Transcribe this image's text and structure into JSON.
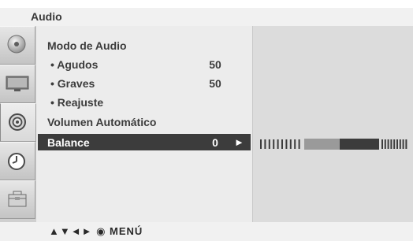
{
  "title": "Audio",
  "icons": [
    "picture-icon",
    "screen-icon",
    "audio-icon",
    "time-icon",
    "option-icon"
  ],
  "active_icon": "audio-icon",
  "menu": {
    "items": [
      {
        "label": "Modo de Audio",
        "value": ""
      },
      {
        "label": "• Agudos",
        "value": "50"
      },
      {
        "label": "• Graves",
        "value": "50"
      },
      {
        "label": "• Reajuste",
        "value": ""
      },
      {
        "label": "Volumen Automático",
        "value": ""
      },
      {
        "label": "Balance",
        "value": "0",
        "arrow": "►"
      }
    ],
    "selected": "Balance"
  },
  "balance": {
    "value": 0,
    "range": [
      -50,
      50
    ]
  },
  "footer": {
    "nav_hint": "▲▼◄► ◉ MENÚ"
  },
  "colors": {
    "selected_bg": "#3c3c3c",
    "panel_bg": "#ececec",
    "sub_panel_bg": "#dcdcdc",
    "bar_dark": "#3c3c3c",
    "bar_mid": "#9a9a9a"
  }
}
